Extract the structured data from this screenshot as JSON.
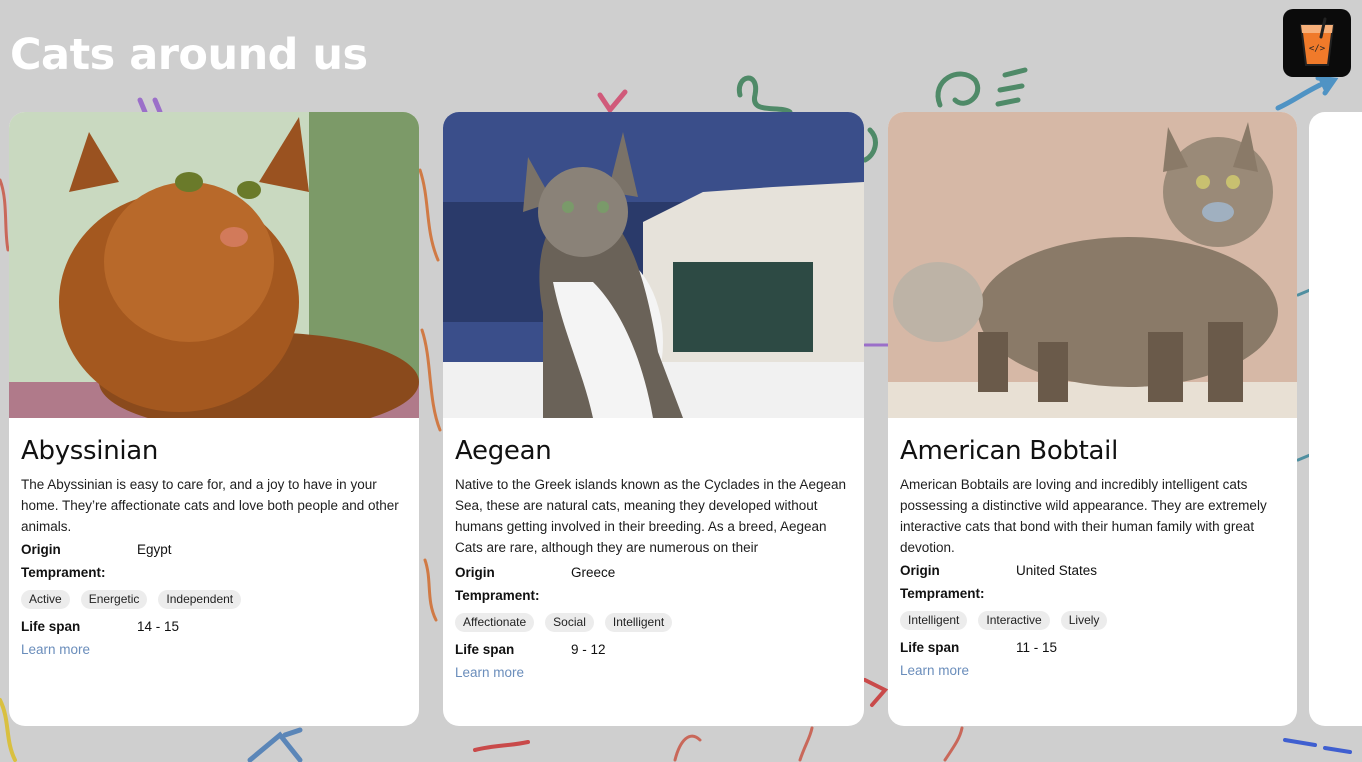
{
  "page": {
    "title": "Cats around us",
    "logo_icon": "code-cup-icon",
    "accent_color": "#6a8dbb",
    "background_color": "#cfcfcf"
  },
  "cards": [
    {
      "name": "Abyssinian",
      "description": "The Abyssinian is easy to care for, and a joy to have in your home. They’re affectionate cats and love both people and other animals.",
      "origin_label": "Origin",
      "origin": "Egypt",
      "temperament_label": "Temprament:",
      "temperament": [
        "Active",
        "Energetic",
        "Independent"
      ],
      "lifespan_label": "Life span",
      "lifespan": "14 - 15",
      "learn_more": "Learn more"
    },
    {
      "name": "Aegean",
      "description": "Native to the Greek islands known as the Cyclades in the Aegean Sea, these are natural cats, meaning they developed without humans getting involved in their breeding. As a breed, Aegean Cats are rare, although they are numerous on their",
      "origin_label": "Origin",
      "origin": "Greece",
      "temperament_label": "Temprament:",
      "temperament": [
        "Affectionate",
        "Social",
        "Intelligent"
      ],
      "lifespan_label": "Life span",
      "lifespan": "9 - 12",
      "learn_more": "Learn more"
    },
    {
      "name": "American Bobtail",
      "description": "American Bobtails are loving and incredibly intelligent cats possessing a distinctive wild appearance. They are extremely interactive cats that bond with their human family with great devotion.",
      "origin_label": "Origin",
      "origin": "United States",
      "temperament_label": "Temprament:",
      "temperament": [
        "Intelligent",
        "Interactive",
        "Lively"
      ],
      "lifespan_label": "Life span",
      "lifespan": "11 - 15",
      "learn_more": "Learn more"
    }
  ]
}
